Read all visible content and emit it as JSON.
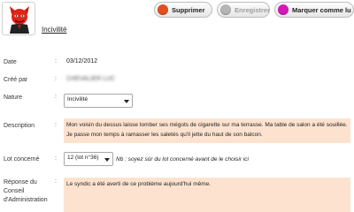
{
  "header": {
    "title": "Incivilité",
    "avatar_icon": "devil-icon"
  },
  "toolbar": {
    "buttons": [
      {
        "label": "Supprimer",
        "color": "#e0501e",
        "enabled": true
      },
      {
        "label": "Enregistrer",
        "color": "#b5b5b5",
        "enabled": false
      },
      {
        "label": "Marquer comme lu",
        "color": "#d21ab7",
        "enabled": true
      }
    ]
  },
  "form": {
    "date": {
      "label": "Date",
      "value": "03/12/2012"
    },
    "created_by": {
      "label": "Créé par",
      "value": "CHEVALIER LUC"
    },
    "nature": {
      "label": "Nature",
      "selected": "Incivilité"
    },
    "description": {
      "label": "Description",
      "text": "Mon voisin du dessus laisse tomber ses mégots de cigarette sur ma terrasse. Ma table de salon a été souillée. Je passe mon temps à ramasser les saletés qu'il jette du haut de son balcon."
    },
    "lot": {
      "label": "Lot concerné",
      "selected": "12 (lot n°36)",
      "note": "Nb : soyez sûr du lot concerné avant de le choisir ici"
    },
    "response": {
      "label_lines": [
        "Réponse du",
        "Conseil",
        "d'Administration"
      ],
      "text": "Le syndic a été averti de ce problème aujourd'hui même."
    }
  }
}
